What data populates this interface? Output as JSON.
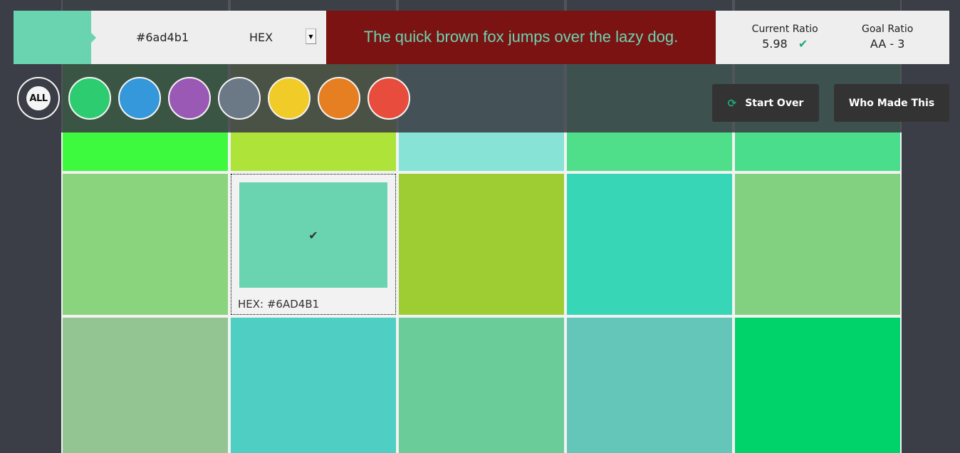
{
  "header": {
    "current_color": "#6ad4b1",
    "hex_value": "#6ad4b1",
    "format": "HEX",
    "preview_text": "The quick brown fox jumps over the lazy dog.",
    "preview_bg": "#7b1313",
    "preview_fg": "#6ad4b1",
    "current_ratio_label": "Current Ratio",
    "current_ratio_value": "5.98",
    "current_ratio_icon": "check-icon",
    "goal_ratio_label": "Goal Ratio",
    "goal_ratio_value": "AA - 3"
  },
  "filters": {
    "all_label": "ALL",
    "colors": [
      {
        "name": "green",
        "hex": "#2ecc71"
      },
      {
        "name": "blue",
        "hex": "#3498db"
      },
      {
        "name": "purple",
        "hex": "#9b59b6"
      },
      {
        "name": "gray",
        "hex": "#6b7886"
      },
      {
        "name": "yellow",
        "hex": "#f1cb27"
      },
      {
        "name": "orange",
        "hex": "#e67e22"
      },
      {
        "name": "red",
        "hex": "#e74c3c"
      }
    ]
  },
  "buttons": {
    "start_over": "Start Over",
    "who_made_this": "Who Made This"
  },
  "grid": {
    "rows": [
      [
        "#3a5a4e",
        "#3c5c52",
        "#3a4a4e",
        "#3e4a50",
        "#3e4a4c"
      ],
      [
        "#3dfa3f",
        "#aee43a",
        "#86e3d6",
        "#4fde8a",
        "#4ade8c"
      ],
      [
        "#8ad47e",
        "#6ad4b1",
        "#9ecd33",
        "#37d6b6",
        "#81d180"
      ],
      [
        "#93c593",
        "#4fcec4",
        "#69cc99",
        "#64c6b9",
        "#00d36a"
      ]
    ],
    "selected": {
      "row": 2,
      "col": 1,
      "label": "HEX: #6AD4B1",
      "icon": "check-icon"
    }
  }
}
